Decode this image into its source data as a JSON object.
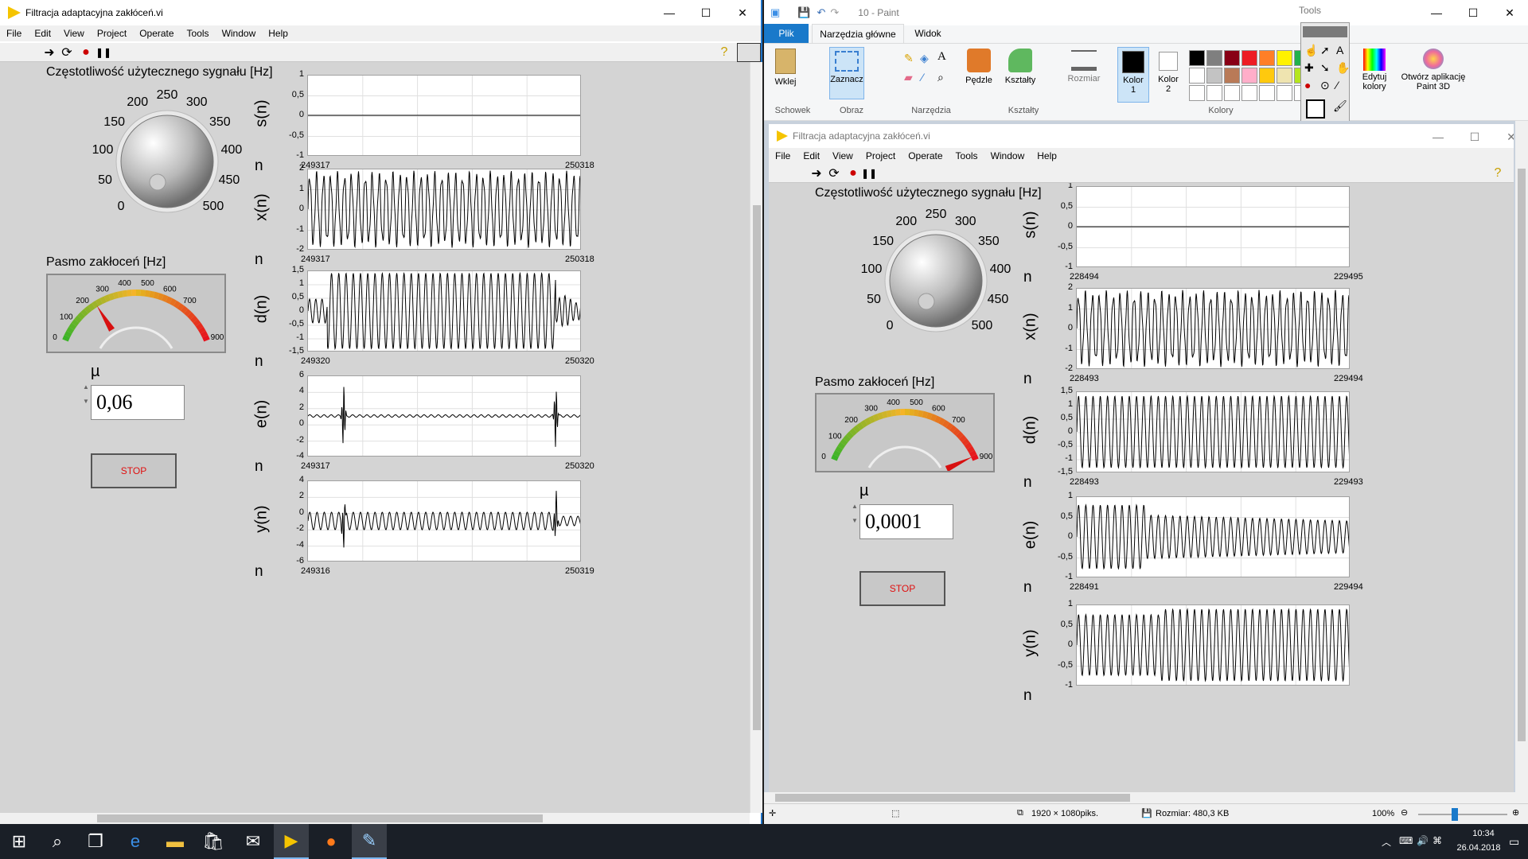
{
  "left_window": {
    "title": "Filtracja adaptacyjna zakłóceń.vi",
    "menu": [
      "File",
      "Edit",
      "View",
      "Project",
      "Operate",
      "Tools",
      "Window",
      "Help"
    ],
    "freq_label": "Częstotliwość użytecznego sygnału [Hz]",
    "knob_scale": [
      "0",
      "50",
      "100",
      "150",
      "200",
      "250",
      "300",
      "350",
      "400",
      "450",
      "500"
    ],
    "noise_label": "Pasmo zakłoceń [Hz]",
    "gauge_scale": [
      "0",
      "100",
      "200",
      "300",
      "400",
      "500",
      "600",
      "700",
      "900"
    ],
    "gauge_value": 240,
    "mu_label": "µ",
    "mu_value": "0,06",
    "stop_label": "STOP",
    "charts": [
      {
        "ylabel": "s(n)",
        "yticks": [
          "1",
          "0,5",
          "0",
          "-0,5",
          "-1"
        ],
        "xstart": "249317",
        "xend": "250318",
        "kind": "flat"
      },
      {
        "ylabel": "x(n)",
        "yticks": [
          "2",
          "1",
          "0",
          "-1",
          "-2"
        ],
        "xstart": "249317",
        "xend": "250318",
        "kind": "dense"
      },
      {
        "ylabel": "d(n)",
        "yticks": [
          "1,5",
          "1",
          "0,5",
          "0",
          "-0,5",
          "-1",
          "-1,5"
        ],
        "xstart": "249320",
        "xend": "250320",
        "kind": "d"
      },
      {
        "ylabel": "e(n)",
        "yticks": [
          "6",
          "4",
          "2",
          "0",
          "-2",
          "-4"
        ],
        "xstart": "249317",
        "xend": "250320",
        "kind": "e"
      },
      {
        "ylabel": "y(n)",
        "yticks": [
          "4",
          "2",
          "0",
          "-2",
          "-4",
          "-6"
        ],
        "xstart": "249316",
        "xend": "250319",
        "kind": "y"
      }
    ],
    "n_label": "n"
  },
  "paint": {
    "title": "10 - Paint",
    "tabs": [
      "Plik",
      "Narzędzia główne",
      "Widok"
    ],
    "groups": [
      "Schowek",
      "Obraz",
      "Narzędzia",
      "Kształty",
      "Kolory"
    ],
    "buttons": {
      "paste": "Wklej",
      "select": "Zaznacz",
      "brushes": "Pędzle",
      "shapes": "Kształty",
      "size": "Rozmiar",
      "color1": "Kolor\n1",
      "color2": "Kolor\n2",
      "edit_colors": "Edytuj\nkolory",
      "paint3d": "Otwórz aplikację\nPaint 3D"
    },
    "tools_label": "Tools",
    "status": {
      "dims": "1920 × 1080piks.",
      "size": "Rozmiar: 480,3 KB",
      "zoom": "100%"
    },
    "palette": [
      "#000000",
      "#7f7f7f",
      "#880015",
      "#ed1c24",
      "#ff7f27",
      "#fff200",
      "#22b14c",
      "#00a2e8",
      "#ffffff",
      "#c3c3c3",
      "#b97a57",
      "#ffaec9",
      "#ffc90e",
      "#efe4b0",
      "#b5e61d",
      "#99d9ea",
      "#ffffff",
      "#ffffff",
      "#ffffff",
      "#ffffff",
      "#ffffff",
      "#ffffff",
      "#ffffff",
      "#ffffff"
    ]
  },
  "right_window": {
    "title": "Filtracja adaptacyjna zakłóceń.vi",
    "menu": [
      "File",
      "Edit",
      "View",
      "Project",
      "Operate",
      "Tools",
      "Window",
      "Help"
    ],
    "freq_label": "Częstotliwość użytecznego sygnału [Hz]",
    "noise_label": "Pasmo zakłoceń [Hz]",
    "gauge_value": 880,
    "mu_label": "µ",
    "mu_value": "0,0001",
    "stop_label": "STOP",
    "charts": [
      {
        "ylabel": "s(n)",
        "yticks": [
          "1",
          "0,5",
          "0",
          "-0,5",
          "-1"
        ],
        "xstart": "228494",
        "xend": "229495",
        "kind": "flat"
      },
      {
        "ylabel": "x(n)",
        "yticks": [
          "2",
          "1",
          "0",
          "-1",
          "-2"
        ],
        "xstart": "228493",
        "xend": "229494",
        "kind": "dense"
      },
      {
        "ylabel": "d(n)",
        "yticks": [
          "1,5",
          "1",
          "0,5",
          "0",
          "-0,5",
          "-1",
          "-1,5"
        ],
        "xstart": "228493",
        "xend": "229493",
        "kind": "d2"
      },
      {
        "ylabel": "e(n)",
        "yticks": [
          "1",
          "0,5",
          "0",
          "-0,5",
          "-1"
        ],
        "xstart": "228491",
        "xend": "229494",
        "kind": "e2"
      },
      {
        "ylabel": "y(n)",
        "yticks": [
          "1",
          "0,5",
          "0",
          "-0,5",
          "-1"
        ],
        "xstart": "",
        "xend": "",
        "kind": "y2"
      }
    ],
    "n_label": "n"
  },
  "taskbar": {
    "time": "10:34",
    "date": "26.04.2018"
  }
}
